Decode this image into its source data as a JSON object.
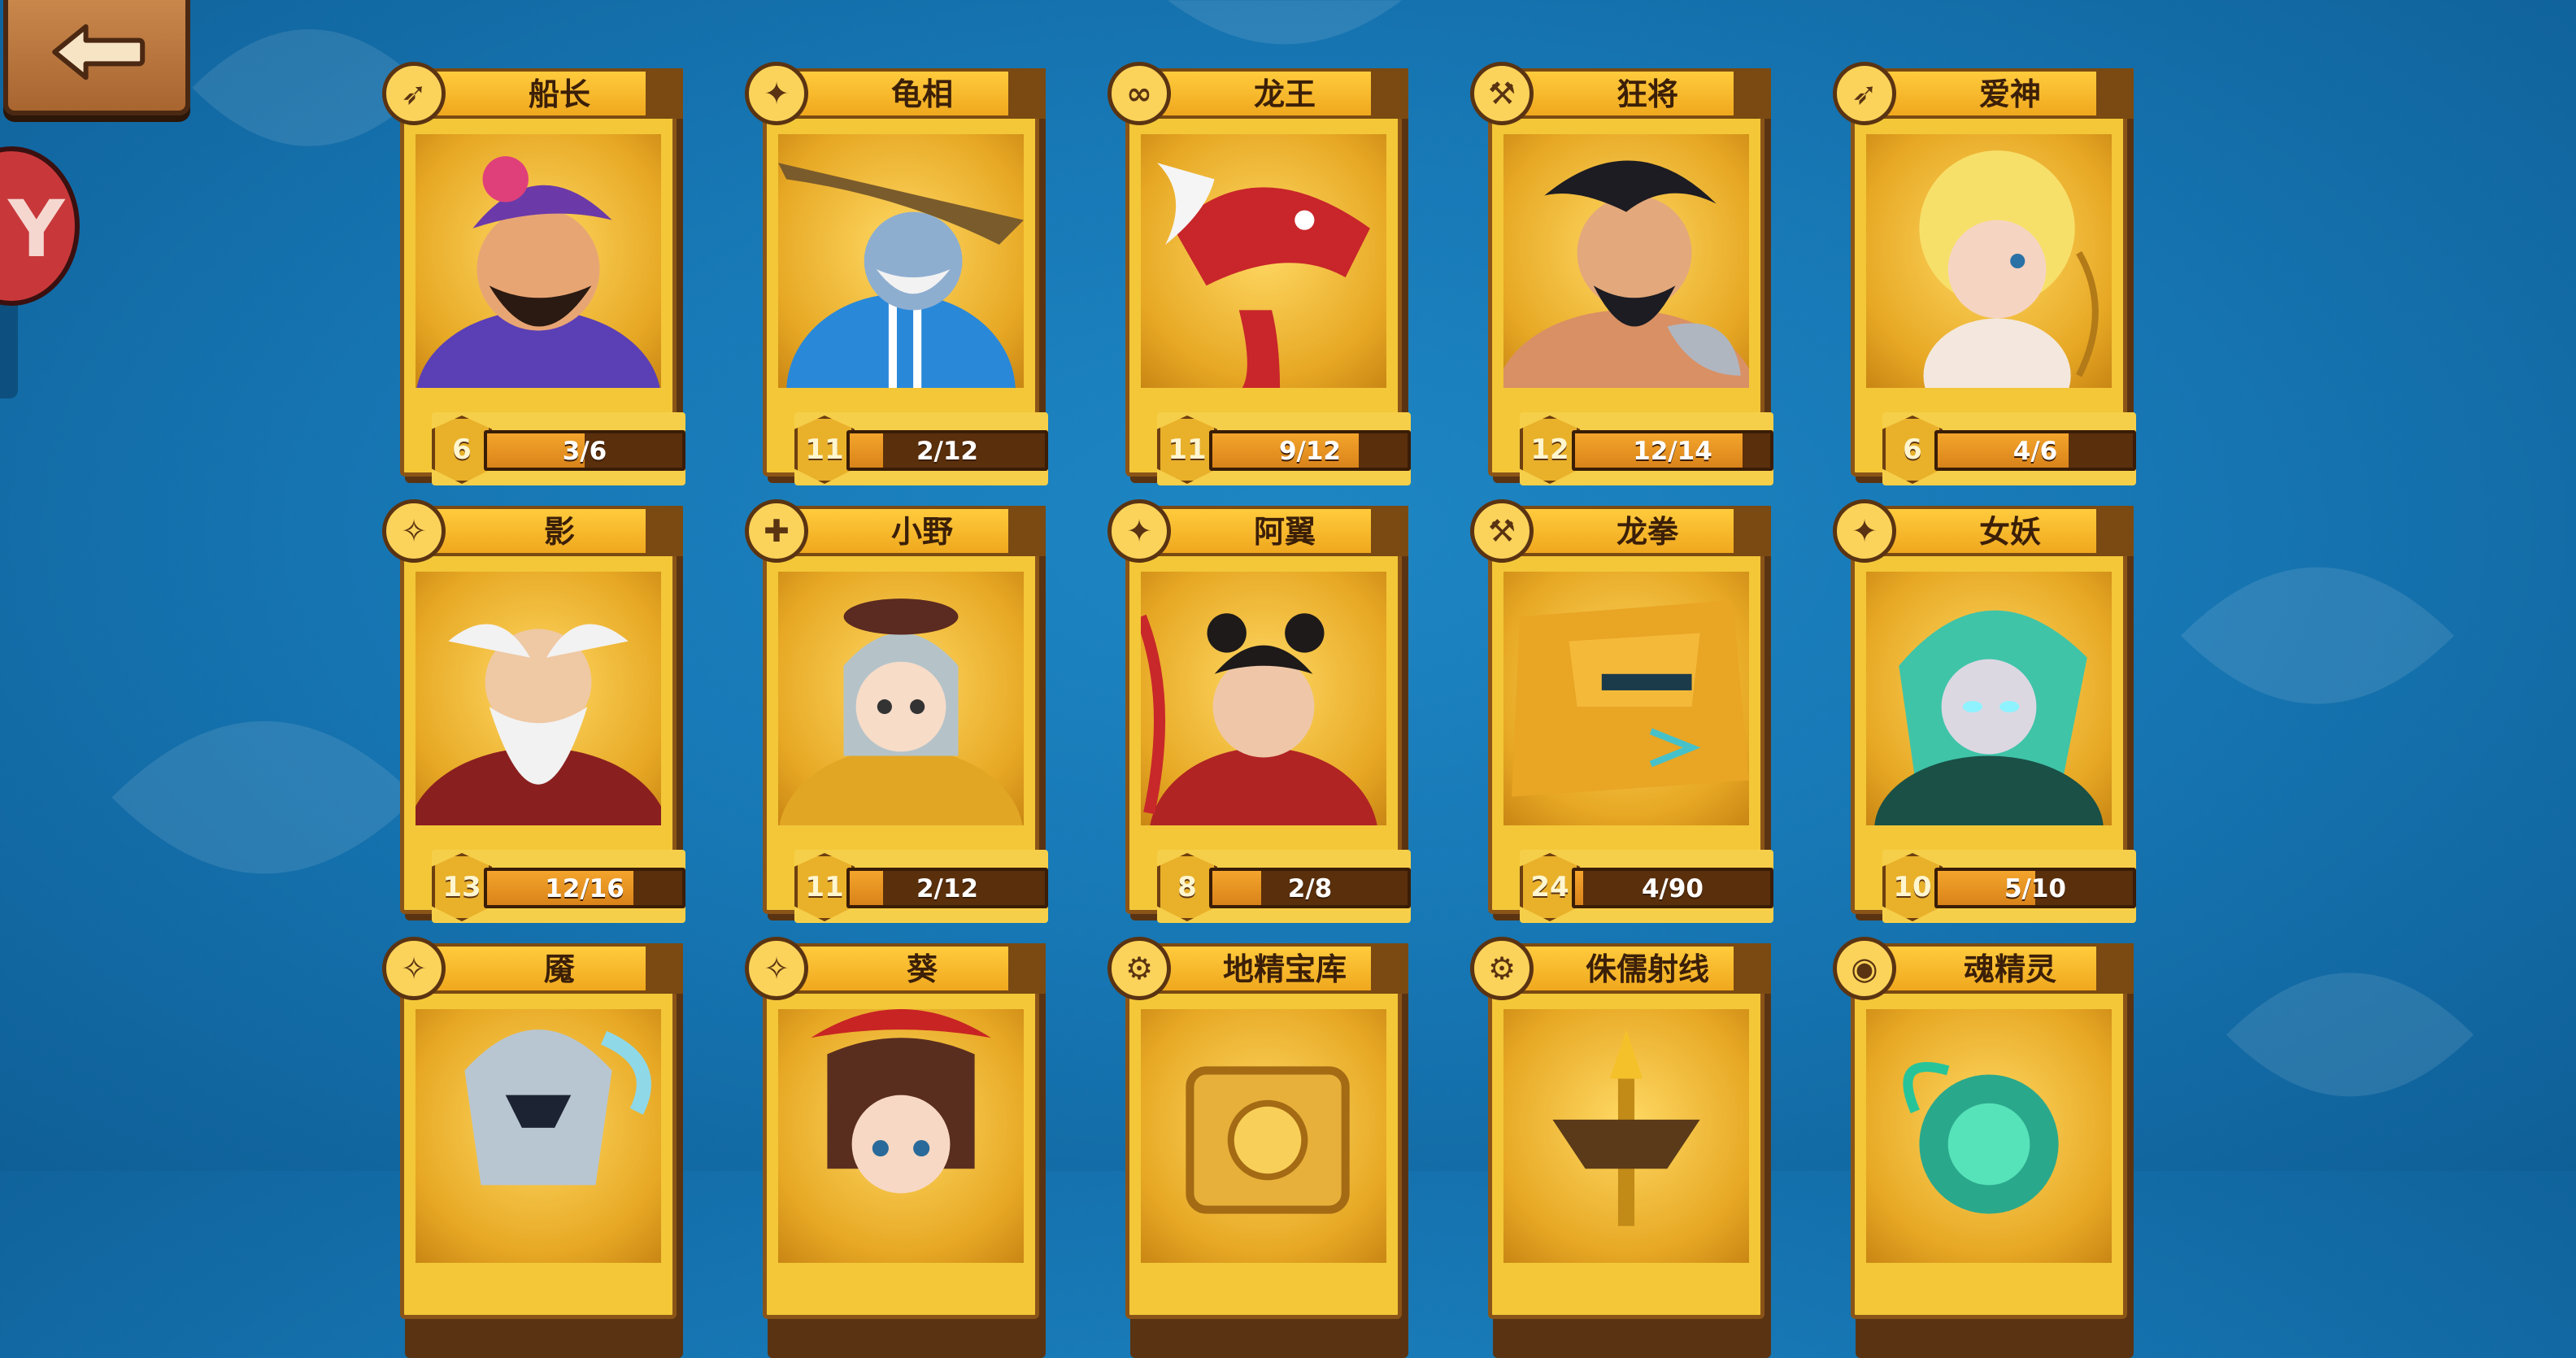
{
  "back_button": {
    "icon": "back-arrow-icon"
  },
  "side_badge": {
    "glyph": "Y"
  },
  "colors": {
    "background": "#1778b5",
    "card_gold": "#f3c738",
    "card_border": "#8a5418",
    "bar_fill": "#f4a52c",
    "bar_track": "#5a2f0c"
  },
  "cards": [
    {
      "name": "船长",
      "role_icon": "bow-icon",
      "role_glyph": "➶",
      "level": "6",
      "progress": "3/6",
      "fraction": 0.5,
      "portrait": "pirate-captain"
    },
    {
      "name": "龟相",
      "role_icon": "staff-icon",
      "role_glyph": "✦",
      "level": "11",
      "progress": "2/12",
      "fraction": 0.167,
      "portrait": "turtle-sage"
    },
    {
      "name": "龙王",
      "role_icon": "infinity-icon",
      "role_glyph": "∞",
      "level": "11",
      "progress": "9/12",
      "fraction": 0.75,
      "portrait": "dragon-king"
    },
    {
      "name": "狂将",
      "role_icon": "axe-icon",
      "role_glyph": "⚒",
      "level": "12",
      "progress": "12/14",
      "fraction": 0.857,
      "portrait": "berserker-general"
    },
    {
      "name": "爱神",
      "role_icon": "bow-icon",
      "role_glyph": "➶",
      "level": "6",
      "progress": "4/6",
      "fraction": 0.667,
      "portrait": "cupid"
    },
    {
      "name": "影",
      "role_icon": "shuriken-icon",
      "role_glyph": "✧",
      "level": "13",
      "progress": "12/16",
      "fraction": 0.75,
      "portrait": "white-beard-elder"
    },
    {
      "name": "小野",
      "role_icon": "sparkle-plus-icon",
      "role_glyph": "✚",
      "level": "11",
      "progress": "2/12",
      "fraction": 0.167,
      "portrait": "silver-hair-girl"
    },
    {
      "name": "阿翼",
      "role_icon": "staff-icon",
      "role_glyph": "✦",
      "level": "8",
      "progress": "2/8",
      "fraction": 0.25,
      "portrait": "young-warrior"
    },
    {
      "name": "龙拳",
      "role_icon": "axe-icon",
      "role_glyph": "⚒",
      "level": "24",
      "progress": "4/90",
      "fraction": 0.044,
      "portrait": "gold-mech"
    },
    {
      "name": "女妖",
      "role_icon": "staff-icon",
      "role_glyph": "✦",
      "level": "10",
      "progress": "5/10",
      "fraction": 0.5,
      "portrait": "green-hair-banshee"
    },
    {
      "name": "魇",
      "role_icon": "shuriken-icon",
      "role_glyph": "✧",
      "portrait": "armored-knight"
    },
    {
      "name": "葵",
      "role_icon": "shuriken-icon",
      "role_glyph": "✧",
      "portrait": "red-bow-girl"
    },
    {
      "name": "地精宝库",
      "role_icon": "gear-icon",
      "role_glyph": "⚙",
      "portrait": "goblin-vault"
    },
    {
      "name": "侏儒射线",
      "role_icon": "gear-icon",
      "role_glyph": "⚙",
      "portrait": "gnome-ray-tower"
    },
    {
      "name": "魂精灵",
      "role_icon": "orb-icon",
      "role_glyph": "◉",
      "portrait": "soul-sprite"
    }
  ]
}
